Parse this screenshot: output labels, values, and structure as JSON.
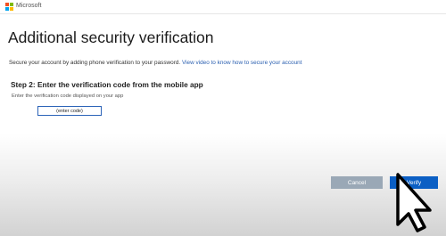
{
  "header": {
    "brand": "Microsoft",
    "logo_colors": [
      "#f25022",
      "#7fba00",
      "#00a4ef",
      "#ffb900"
    ]
  },
  "page": {
    "title": "Additional security verification",
    "description_prefix": "Secure your account by adding phone verification to your password.",
    "video_link": "View video to know how to secure your account"
  },
  "step": {
    "heading": "Step 2: Enter the verification code from the mobile app",
    "instruction": "Enter the verification code displayed on your app",
    "code_input": {
      "value": "",
      "placeholder": "(enter code)"
    }
  },
  "buttons": {
    "cancel": "Cancel",
    "verify": "Verify"
  },
  "icons": {
    "cursor": "mouse-pointer-icon"
  },
  "colors": {
    "link": "#2a5fb0",
    "verify_button": "#0b5fc4",
    "cancel_button": "#9aa8b6",
    "input_border": "#2b63b8"
  }
}
